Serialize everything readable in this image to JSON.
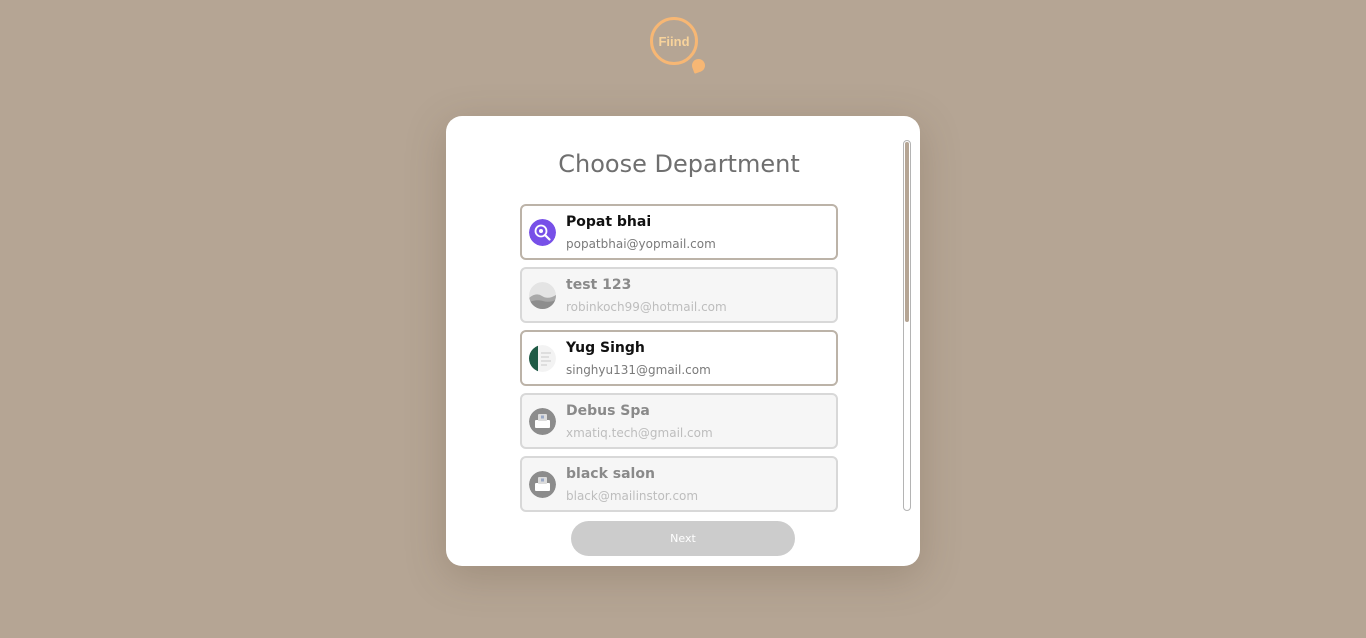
{
  "logo": {
    "text": "Fiind"
  },
  "page": {
    "title": "Choose Department"
  },
  "departments": [
    {
      "name": "Popat bhai",
      "email": "popatbhai@yopmail.com",
      "enabled": true,
      "avatar": "search-logo-icon"
    },
    {
      "name": "test 123",
      "email": "robinkoch99@hotmail.com",
      "enabled": false,
      "avatar": "landscape-photo"
    },
    {
      "name": "Yug Singh",
      "email": "singhyu131@gmail.com",
      "enabled": true,
      "avatar": "document-thumbnail"
    },
    {
      "name": "Debus Spa",
      "email": "xmatiq.tech@gmail.com",
      "enabled": false,
      "avatar": "store-icon"
    },
    {
      "name": "black salon",
      "email": "black@mailinstor.com",
      "enabled": false,
      "avatar": "store-icon"
    }
  ],
  "actions": {
    "next_label": "Next"
  },
  "colors": {
    "background": "#b5a594",
    "accent": "#f7b774",
    "button_disabled": "#cccccc"
  }
}
